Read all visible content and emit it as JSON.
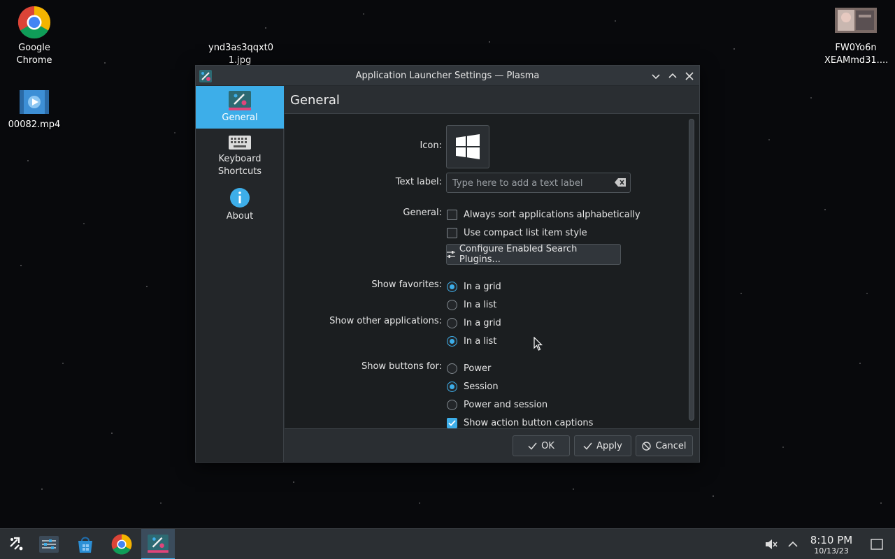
{
  "desktop": {
    "icons": [
      {
        "label": "Google Chrome"
      },
      {
        "label": "00082.mp4"
      },
      {
        "label": "ynd3as3qqxt0 1.jpg"
      },
      {
        "label": "FW0Yo6n XEAMmd31...."
      }
    ]
  },
  "dialog": {
    "title": "Application Launcher Settings — Plasma",
    "sidebar": {
      "items": [
        {
          "label": "General",
          "icon": "kickoff-icon",
          "active": true
        },
        {
          "label": "Keyboard Shortcuts",
          "icon": "keyboard-icon"
        },
        {
          "label": "About",
          "icon": "info-icon"
        }
      ]
    },
    "page_title": "General",
    "form": {
      "icon_label": "Icon:",
      "text_label_label": "Text label:",
      "text_label_placeholder": "Type here to add a text label",
      "text_label_value": "",
      "general_label": "General:",
      "sort_alpha_label": "Always sort applications alphabetically",
      "sort_alpha_checked": false,
      "compact_label": "Use compact list item style",
      "compact_checked": false,
      "configure_plugins_label": "Configure Enabled Search Plugins...",
      "show_favorites_label": "Show favorites:",
      "favorites_options": [
        "In a grid",
        "In a list"
      ],
      "favorites_selected": "In a grid",
      "show_other_label": "Show other applications:",
      "other_options": [
        "In a grid",
        "In a list"
      ],
      "other_selected": "In a list",
      "show_buttons_label": "Show buttons for:",
      "buttons_options": [
        "Power",
        "Session",
        "Power and session"
      ],
      "buttons_selected": "Session",
      "captions_label": "Show action button captions",
      "captions_checked": true
    },
    "buttons": {
      "ok": "OK",
      "apply": "Apply",
      "cancel": "Cancel"
    }
  },
  "taskbar": {
    "time": "8:10 PM",
    "date": "10/13/23"
  },
  "colors": {
    "accent": "#3daee9",
    "window_bg": "#2a2e32",
    "view_bg": "#1b1e20"
  }
}
